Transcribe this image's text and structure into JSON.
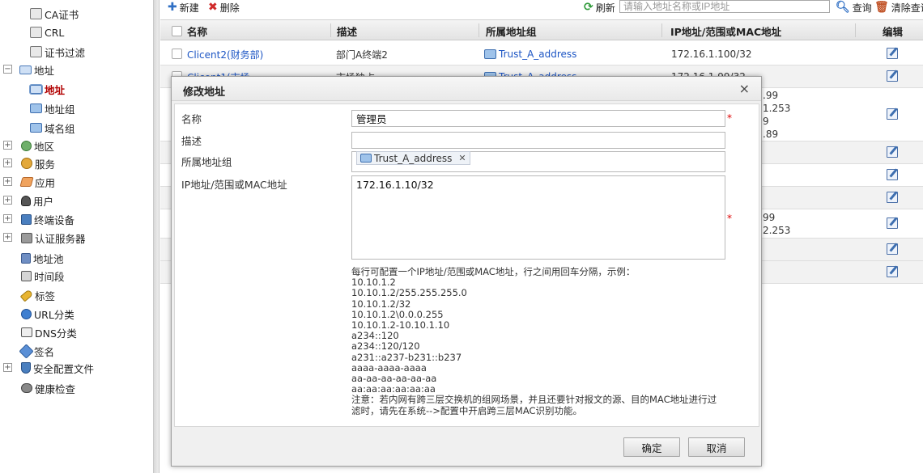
{
  "sidebar": {
    "items": [
      {
        "label": "CA证书",
        "icon": "certificate-icon"
      },
      {
        "label": "CRL",
        "icon": "crl-icon"
      },
      {
        "label": "证书过滤",
        "icon": "cert-filter-icon"
      },
      {
        "label": "地址",
        "icon": "monitor-icon",
        "expander": "−"
      },
      {
        "label": "地址",
        "icon": "monitor-icon",
        "selected": true
      },
      {
        "label": "地址组",
        "icon": "address-group-icon"
      },
      {
        "label": "域名组",
        "icon": "domain-group-icon"
      },
      {
        "label": "地区",
        "icon": "globe-icon",
        "expander": "+"
      },
      {
        "label": "服务",
        "icon": "service-icon",
        "expander": "+"
      },
      {
        "label": "应用",
        "icon": "application-icon",
        "expander": "+"
      },
      {
        "label": "用户",
        "icon": "user-icon",
        "expander": "+"
      },
      {
        "label": "终端设备",
        "icon": "terminal-device-icon",
        "expander": "+"
      },
      {
        "label": "认证服务器",
        "icon": "auth-server-icon",
        "expander": "+"
      },
      {
        "label": "地址池",
        "icon": "address-pool-icon"
      },
      {
        "label": "时间段",
        "icon": "clock-icon"
      },
      {
        "label": "标签",
        "icon": "tag-icon"
      },
      {
        "label": "URL分类",
        "icon": "url-category-icon"
      },
      {
        "label": "DNS分类",
        "icon": "dns-category-icon"
      },
      {
        "label": "签名",
        "icon": "signature-icon"
      },
      {
        "label": "安全配置文件",
        "icon": "security-profile-icon",
        "expander": "+"
      },
      {
        "label": "健康检查",
        "icon": "health-check-icon"
      }
    ]
  },
  "toolbar": {
    "new_label": "新建",
    "delete_label": "删除",
    "refresh_label": "刷新",
    "search_placeholder": "请输入地址名称或IP地址",
    "query_label": "查询",
    "clear_label": "清除查询"
  },
  "table": {
    "headers": [
      "名称",
      "描述",
      "所属地址组",
      "IP地址/范围或MAC地址",
      "编辑"
    ],
    "rows": [
      {
        "name": "Clicent2(财务部)",
        "desc": "部门A终端2",
        "group": "Trust_A_address",
        "ip": "172.16.1.100/32"
      },
      {
        "name": "Clicent1(市场",
        "desc": "市场独占",
        "group": "Trust_A_address",
        "ip": "172.16.1.99/32"
      }
    ],
    "peek_texts": [
      ".99",
      "1.253",
      "9",
      ".89",
      "99",
      "2.253"
    ]
  },
  "modal": {
    "title": "修改地址",
    "close_glyph": "×",
    "fields": {
      "name_label": "名称",
      "name_value": "管理员",
      "desc_label": "描述",
      "desc_value": "",
      "group_label": "所属地址组",
      "group_tag": "Trust_A_address",
      "ip_label": "IP地址/范围或MAC地址",
      "ip_value": "172.16.1.10/32",
      "required_mark": "*"
    },
    "hint_text": "每行可配置一个IP地址/范围或MAC地址，行之间用回车分隔，示例：\n10.10.1.2\n10.10.1.2/255.255.255.0\n10.10.1.2/32\n10.10.1.2\\0.0.0.255\n10.10.1.2-10.10.1.10\na234::120\na234::120/120\na231::a237-b231::b237\naaaa-aaaa-aaaa\naa-aa-aa-aa-aa-aa\naa:aa:aa:aa:aa:aa\n注意：若内网有跨三层交换机的组网场景，并且还要针对报文的源、目的MAC地址进行过\n滤时，请先在系统-->配置中开启跨三层MAC识别功能。",
    "ok_label": "确定",
    "cancel_label": "取消"
  }
}
